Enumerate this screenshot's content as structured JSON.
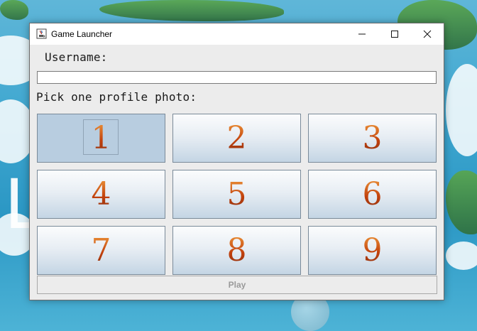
{
  "window": {
    "title": "Game Launcher",
    "icon": "java-cup-icon"
  },
  "window_controls": {
    "minimize_icon": "minimize-icon",
    "maximize_icon": "maximize-icon",
    "close_icon": "close-icon"
  },
  "form": {
    "username_label": "Username:",
    "username_value": "",
    "photo_label": "Pick one profile photo:"
  },
  "profile_photos": [
    {
      "label": "1",
      "selected": true
    },
    {
      "label": "2",
      "selected": false
    },
    {
      "label": "3",
      "selected": false
    },
    {
      "label": "4",
      "selected": false
    },
    {
      "label": "5",
      "selected": false
    },
    {
      "label": "6",
      "selected": false
    },
    {
      "label": "7",
      "selected": false
    },
    {
      "label": "8",
      "selected": false
    },
    {
      "label": "9",
      "selected": false
    }
  ],
  "play_button": {
    "label": "Play",
    "enabled": false
  },
  "desktop": {
    "wallpaper_glyph": "L"
  },
  "colors": {
    "digit_gradient_top": "#f4a442",
    "digit_gradient_bottom": "#7c2d12",
    "selected_tile": "#b8cde0",
    "disabled_text": "#9a9a9a"
  }
}
